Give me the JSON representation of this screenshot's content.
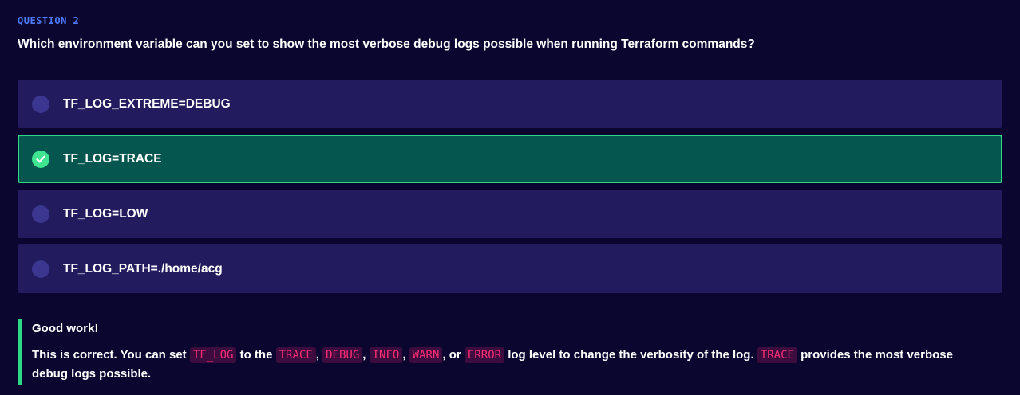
{
  "question": {
    "label": "QUESTION 2",
    "text": "Which environment variable can you set to show the most verbose debug logs possible when running Terraform commands?"
  },
  "options": [
    {
      "label": "TF_LOG_EXTREME=DEBUG",
      "selected": false
    },
    {
      "label": "TF_LOG=TRACE",
      "selected": true
    },
    {
      "label": "TF_LOG=LOW",
      "selected": false
    },
    {
      "label": "TF_LOG_PATH=./home/acg",
      "selected": false
    }
  ],
  "feedback": {
    "title": "Good work!",
    "segments": [
      {
        "text": "This is correct. You can set ",
        "code": false
      },
      {
        "text": "TF_LOG",
        "code": true
      },
      {
        "text": " to the ",
        "code": false
      },
      {
        "text": "TRACE",
        "code": true
      },
      {
        "text": ", ",
        "code": false
      },
      {
        "text": "DEBUG",
        "code": true
      },
      {
        "text": ", ",
        "code": false
      },
      {
        "text": "INFO",
        "code": true
      },
      {
        "text": ", ",
        "code": false
      },
      {
        "text": "WARN",
        "code": true
      },
      {
        "text": ", or ",
        "code": false
      },
      {
        "text": "ERROR",
        "code": true
      },
      {
        "text": " log level to change the verbosity of the log. ",
        "code": false
      },
      {
        "text": "TRACE",
        "code": true
      },
      {
        "text": " provides the most verbose debug logs possible.",
        "code": false
      }
    ]
  },
  "colors": {
    "background": "#0a0630",
    "option_bg": "#221c5e",
    "selected_bg": "#05564f",
    "accent_green": "#2fd887",
    "question_label": "#4e7bff",
    "code_text": "#ff2d75"
  }
}
